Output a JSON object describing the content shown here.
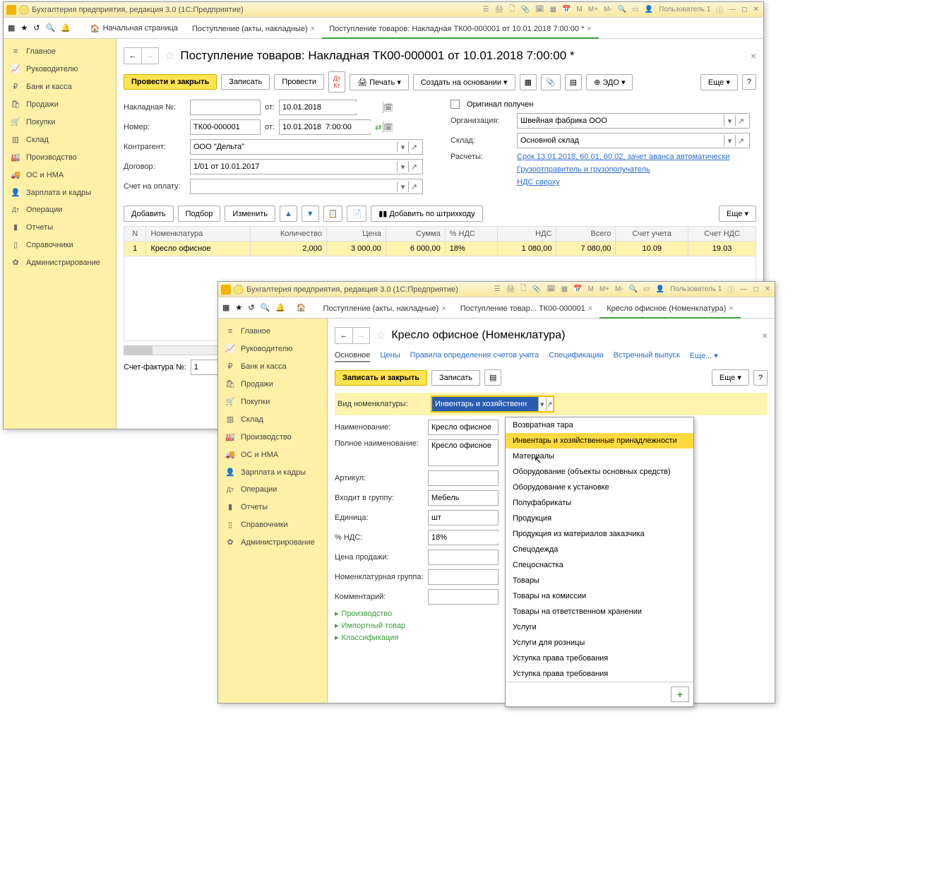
{
  "backWindow": {
    "title": "Бухгалтерия предприятия, редакция 3.0  (1С:Предприятие)",
    "user": "Пользователь 1",
    "toolbarLetters": [
      "M",
      "M+",
      "M-"
    ],
    "tabs": [
      {
        "label": "Начальная страница"
      },
      {
        "label": "Поступление (акты, накладные)",
        "closable": true
      },
      {
        "label": "Поступление товаров: Накладная ТК00-000001 от 10.01.2018 7:00:00 *",
        "closable": true,
        "active": true
      }
    ],
    "sidebar": [
      {
        "icon": "≡",
        "label": "Главное"
      },
      {
        "icon": "📈",
        "label": "Руководителю"
      },
      {
        "icon": "₽",
        "label": "Банк и касса"
      },
      {
        "icon": "🛍",
        "label": "Продажи"
      },
      {
        "icon": "🛒",
        "label": "Покупки"
      },
      {
        "icon": "▥",
        "label": "Склад"
      },
      {
        "icon": "🏭",
        "label": "Производство"
      },
      {
        "icon": "🚚",
        "label": "ОС и НМА"
      },
      {
        "icon": "👤",
        "label": "Зарплата и кадры"
      },
      {
        "icon": "Дт",
        "label": "Операции"
      },
      {
        "icon": "▮",
        "label": "Отчеты"
      },
      {
        "icon": "▯",
        "label": "Справочники"
      },
      {
        "icon": "✿",
        "label": "Администрирование"
      }
    ],
    "docHeader": "Поступление товаров: Накладная ТК00-000001 от 10.01.2018 7:00:00 *",
    "buttons": {
      "postAndClose": "Провести и закрыть",
      "save": "Записать",
      "post": "Провести",
      "print": "Печать",
      "createBase": "Создать на основании",
      "edm": "ЭДО",
      "more": "Еще",
      "help": "?"
    },
    "form": {
      "invoiceNoLabel": "Накладная №:",
      "invoiceNo": "",
      "fromLabel": "от:",
      "date1": "10.01.2018",
      "numberLabel": "Номер:",
      "number": "ТК00-000001",
      "date2": "10.01.2018  7:00:00",
      "contrLabel": "Контрагент:",
      "contr": "ООО \"Дельта\"",
      "contractLabel": "Договор:",
      "contract": "1/01 от 10.01.2017",
      "payAccLabel": "Счет на оплату:",
      "payAcc": "",
      "origLabel": "Оригинал получен",
      "orgLabel": "Организация:",
      "org": "Швейная фабрика ООО",
      "warehouseLabel": "Склад:",
      "warehouse": "Основной склад",
      "calcLabel": "Расчеты:",
      "calcLink": "Срок 13.01.2018, 60.01, 60.02, зачет аванса автоматически",
      "shipperLink": "Грузоотправитель и грузополучатель",
      "vatLink": "НДС сверху"
    },
    "tableToolbar": {
      "add": "Добавить",
      "pick": "Подбор",
      "edit": "Изменить",
      "barcode": "Добавить по штрихкоду",
      "more": "Еще"
    },
    "tableHeaders": [
      "N",
      "Номенклатура",
      "Количество",
      "Цена",
      "Сумма",
      "% НДС",
      "НДС",
      "Всего",
      "Счет учета",
      "Счет НДС"
    ],
    "tableRow": {
      "n": "1",
      "nom": "Кресло офисное",
      "qty": "2,000",
      "price": "3 000,00",
      "sum": "6 000,00",
      "vatRate": "18%",
      "vat": "1 080,00",
      "total": "7 080,00",
      "acc": "10.09",
      "vatAcc": "19.03"
    },
    "bottom": {
      "sfLabel": "Счет-фактура №:",
      "sfNo": "1"
    }
  },
  "frontWindow": {
    "title": "Бухгалтерия предприятия, редакция 3.0  (1С:Предприятие)",
    "user": "Пользователь 1",
    "toolbarLetters": [
      "M",
      "M+",
      "M-"
    ],
    "tabs": [
      {
        "label": "Поступление (акты, накладные)",
        "closable": true
      },
      {
        "label": "Поступление товар... ТК00-000001",
        "closable": true
      },
      {
        "label": "Кресло офисное (Номенклатура)",
        "closable": true,
        "active": true
      }
    ],
    "sidebar": [
      {
        "icon": "≡",
        "label": "Главное"
      },
      {
        "icon": "📈",
        "label": "Руководителю"
      },
      {
        "icon": "₽",
        "label": "Банк и касса"
      },
      {
        "icon": "🛍",
        "label": "Продажи"
      },
      {
        "icon": "🛒",
        "label": "Покупки"
      },
      {
        "icon": "▥",
        "label": "Склад"
      },
      {
        "icon": "🏭",
        "label": "Производство"
      },
      {
        "icon": "🚚",
        "label": "ОС и НМА"
      },
      {
        "icon": "👤",
        "label": "Зарплата и кадры"
      },
      {
        "icon": "Дт",
        "label": "Операции"
      },
      {
        "icon": "▮",
        "label": "Отчеты"
      },
      {
        "icon": "▯",
        "label": "Справочники"
      },
      {
        "icon": "✿",
        "label": "Администрирование"
      }
    ],
    "docHeader": "Кресло офисное (Номенклатура)",
    "sectionTabs": [
      "Основное",
      "Цены",
      "Правила определения счетов учета",
      "Спецификации",
      "Встречный выпуск",
      "Еще..."
    ],
    "buttons": {
      "saveClose": "Записать и закрыть",
      "save": "Записать",
      "more": "Еще",
      "help": "?"
    },
    "form": {
      "typeLabel": "Вид номенклатуры:",
      "typeValue": "Инвентарь и хозяйственн",
      "nameLabel": "Наименование:",
      "name": "Кресло офисное",
      "fullNameLabel": "Полное наименование:",
      "fullName": "Кресло офисное",
      "artLabel": "Артикул:",
      "art": "",
      "groupLabel": "Входит в группу:",
      "group": "Мебель",
      "unitLabel": "Единица:",
      "unit": "шт",
      "vatLabel": "% НДС:",
      "vat": "18%",
      "sellPriceLabel": "Цена продажи:",
      "sellPrice": "",
      "nomGroupLabel": "Номенклатурная группа:",
      "nomGroup": "",
      "commentLabel": "Комментарий:",
      "comment": ""
    },
    "expands": [
      "Производство",
      "Импортный товар",
      "Классификация"
    ],
    "dropdown": {
      "options": [
        "Возвратная тара",
        "Инвентарь и хозяйственные принадлежности",
        "Материалы",
        "Оборудование (объекты основных средств)",
        "Оборудование к установке",
        "Полуфабрикаты",
        "Продукция",
        "Продукция из материалов заказчика",
        "Спецодежда",
        "Спецоснастка",
        "Товары",
        "Товары на комиссии",
        "Товары на ответственном хранении",
        "Услуги",
        "Услуги для розницы",
        "Уступка права требования",
        "Уступка права требования"
      ],
      "selectedIndex": 1,
      "addLabel": "+"
    }
  }
}
